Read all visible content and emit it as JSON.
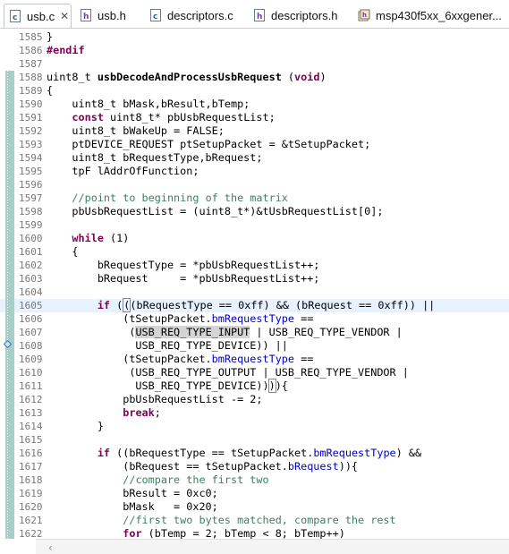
{
  "tabs": [
    {
      "name": "usb.c",
      "kind": "c",
      "active": true
    },
    {
      "name": "usb.h",
      "kind": "h",
      "active": false
    },
    {
      "name": "descriptors.c",
      "kind": "c",
      "active": false
    },
    {
      "name": "descriptors.h",
      "kind": "h",
      "active": false
    },
    {
      "name": "msp430f5xx_6xxgener...",
      "kind": "hex",
      "active": false
    }
  ],
  "lines": [
    {
      "num": "1585",
      "html": "}"
    },
    {
      "num": "1586",
      "html": "<span class=\"kw\">#endif</span>"
    },
    {
      "num": "1587",
      "html": ""
    },
    {
      "num": "1588",
      "html": "uint8_t <b>usbDecodeAndProcessUsbRequest</b> (<span class=\"kw\">void</span>)"
    },
    {
      "num": "1589",
      "html": "{"
    },
    {
      "num": "1590",
      "html": "    uint8_t bMask,bResult,bTemp;"
    },
    {
      "num": "1591",
      "html": "    <span class=\"kw\">const</span> uint8_t* pbUsbRequestList;"
    },
    {
      "num": "1592",
      "html": "    uint8_t bWakeUp = FALSE;"
    },
    {
      "num": "1593",
      "html": "    ptDEVICE_REQUEST ptSetupPacket = &amp;tSetupPacket;"
    },
    {
      "num": "1594",
      "html": "    uint8_t bRequestType,bRequest;"
    },
    {
      "num": "1595",
      "html": "    tpF lAddrOfFunction;"
    },
    {
      "num": "1596",
      "html": ""
    },
    {
      "num": "1597",
      "html": "    <span class=\"cm\">//point to beginning of the matrix</span>"
    },
    {
      "num": "1598",
      "html": "    pbUsbRequestList = (uint8_t*)&amp;tUsbRequestList[0];"
    },
    {
      "num": "1599",
      "html": ""
    },
    {
      "num": "1600",
      "html": "    <span class=\"kw\">while</span> (1)"
    },
    {
      "num": "1601",
      "html": "    {"
    },
    {
      "num": "1602",
      "html": "        bRequestType = *pbUsbRequestList++;"
    },
    {
      "num": "1603",
      "html": "        bRequest     = *pbUsbRequestList++;"
    },
    {
      "num": "1604",
      "html": ""
    },
    {
      "num": "1605",
      "html": "        <span class=\"kw\">if</span> (<span class=\"cursor\"></span><span class=\"caretbox\">(</span>(bRequestType == 0xff) &amp;&amp; (bRequest == 0xff)) ||",
      "current": true
    },
    {
      "num": "1606",
      "html": "            (tSetupPacket.<span class=\"fld\">bmRequestType</span> =="
    },
    {
      "num": "1607",
      "html": "             (<span class=\"hl\">USB_REQ_TYPE_INPUT</span> | USB_REQ_TYPE_VENDOR |"
    },
    {
      "num": "1608",
      "html": "              USB_REQ_TYPE_DEVICE)) ||"
    },
    {
      "num": "1609",
      "html": "            (tSetupPacket.<span class=\"fld\">bmRequestType</span> =="
    },
    {
      "num": "1610",
      "html": "             (USB_REQ_TYPE_OUTPUT | USB_REQ_TYPE_VENDOR |"
    },
    {
      "num": "1611",
      "html": "              USB_REQ_TYPE_DEVICE))<span class=\"caretbox\">)</span>){"
    },
    {
      "num": "1612",
      "html": "            pbUsbRequestList -= 2;"
    },
    {
      "num": "1613",
      "html": "            <span class=\"kw\">break</span>;"
    },
    {
      "num": "1614",
      "html": "        }"
    },
    {
      "num": "1615",
      "html": ""
    },
    {
      "num": "1616",
      "html": "        <span class=\"kw\">if</span> ((bRequestType == tSetupPacket.<span class=\"fld\">bmRequestType</span>) &amp;&amp;"
    },
    {
      "num": "1617",
      "html": "            (bRequest == tSetupPacket.<span class=\"fld\">bRequest</span>)){"
    },
    {
      "num": "1618",
      "html": "            <span class=\"cm\">//compare the first two</span>"
    },
    {
      "num": "1619",
      "html": "            bResult = 0xc0;"
    },
    {
      "num": "1620",
      "html": "            bMask   = 0x20;"
    },
    {
      "num": "1621",
      "html": "            <span class=\"cm\">//first two bytes matched, compare the rest</span>"
    },
    {
      "num": "1622",
      "html": "            <span class=\"kw\">for</span> (bTemp = 2; bTemp &lt; 8; bTemp++)"
    }
  ],
  "changed_gutter_from": "1588",
  "colors": {
    "keyword": "#7f0055",
    "comment": "#3f7f5f",
    "field": "#0000c0",
    "current_line": "#e8f2fe",
    "gutter_change": "#a7cfc8"
  }
}
